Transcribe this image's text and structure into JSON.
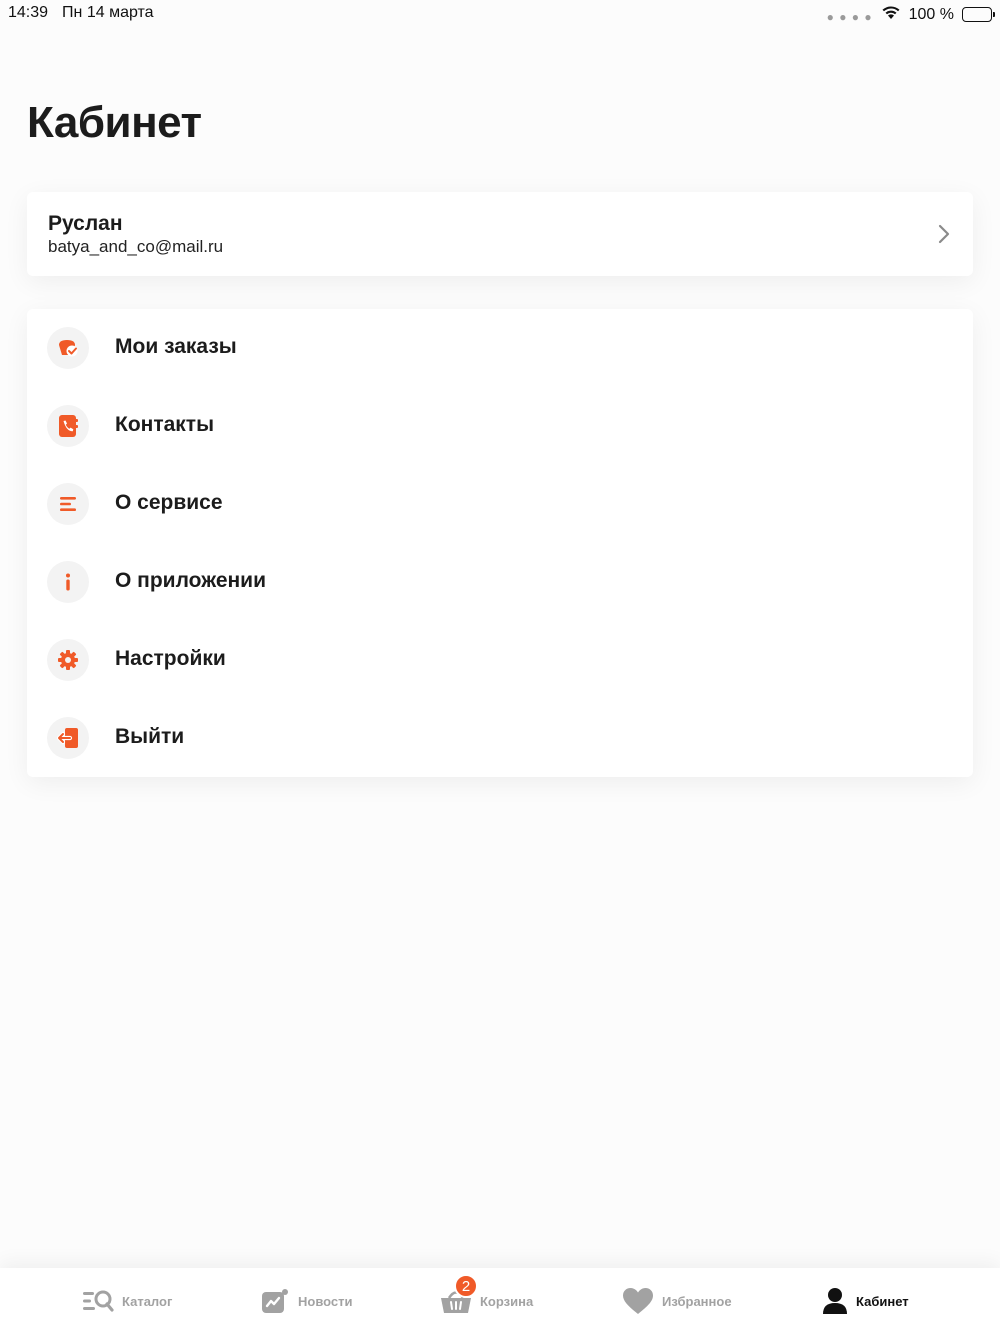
{
  "status_bar": {
    "time": "14:39",
    "date": "Пн 14 марта",
    "battery": "100 %",
    "battery_level": 1.0
  },
  "page": {
    "title": "Кабинет"
  },
  "profile": {
    "name": "Руслан",
    "email": "batya_and_co@mail.ru"
  },
  "menu": {
    "items": [
      {
        "label": "Мои заказы",
        "icon": "orders-icon"
      },
      {
        "label": "Контакты",
        "icon": "phone-book-icon"
      },
      {
        "label": "О сервисе",
        "icon": "list-icon"
      },
      {
        "label": "О приложении",
        "icon": "info-icon"
      },
      {
        "label": "Настройки",
        "icon": "gear-icon"
      },
      {
        "label": "Выйти",
        "icon": "logout-icon"
      }
    ]
  },
  "tab_bar": {
    "tabs": [
      {
        "label": "Каталог",
        "icon": "catalog-search-icon"
      },
      {
        "label": "Новости",
        "icon": "news-chart-icon"
      },
      {
        "label": "Корзина",
        "icon": "basket-icon",
        "badge": "2"
      },
      {
        "label": "Избранное",
        "icon": "heart-icon"
      },
      {
        "label": "Кабинет",
        "icon": "user-icon",
        "active": true
      }
    ]
  },
  "colors": {
    "accent": "#f05a28",
    "inactive": "#a2a2a2",
    "text": "#1c1c1c",
    "background": "#fcfcfc"
  }
}
